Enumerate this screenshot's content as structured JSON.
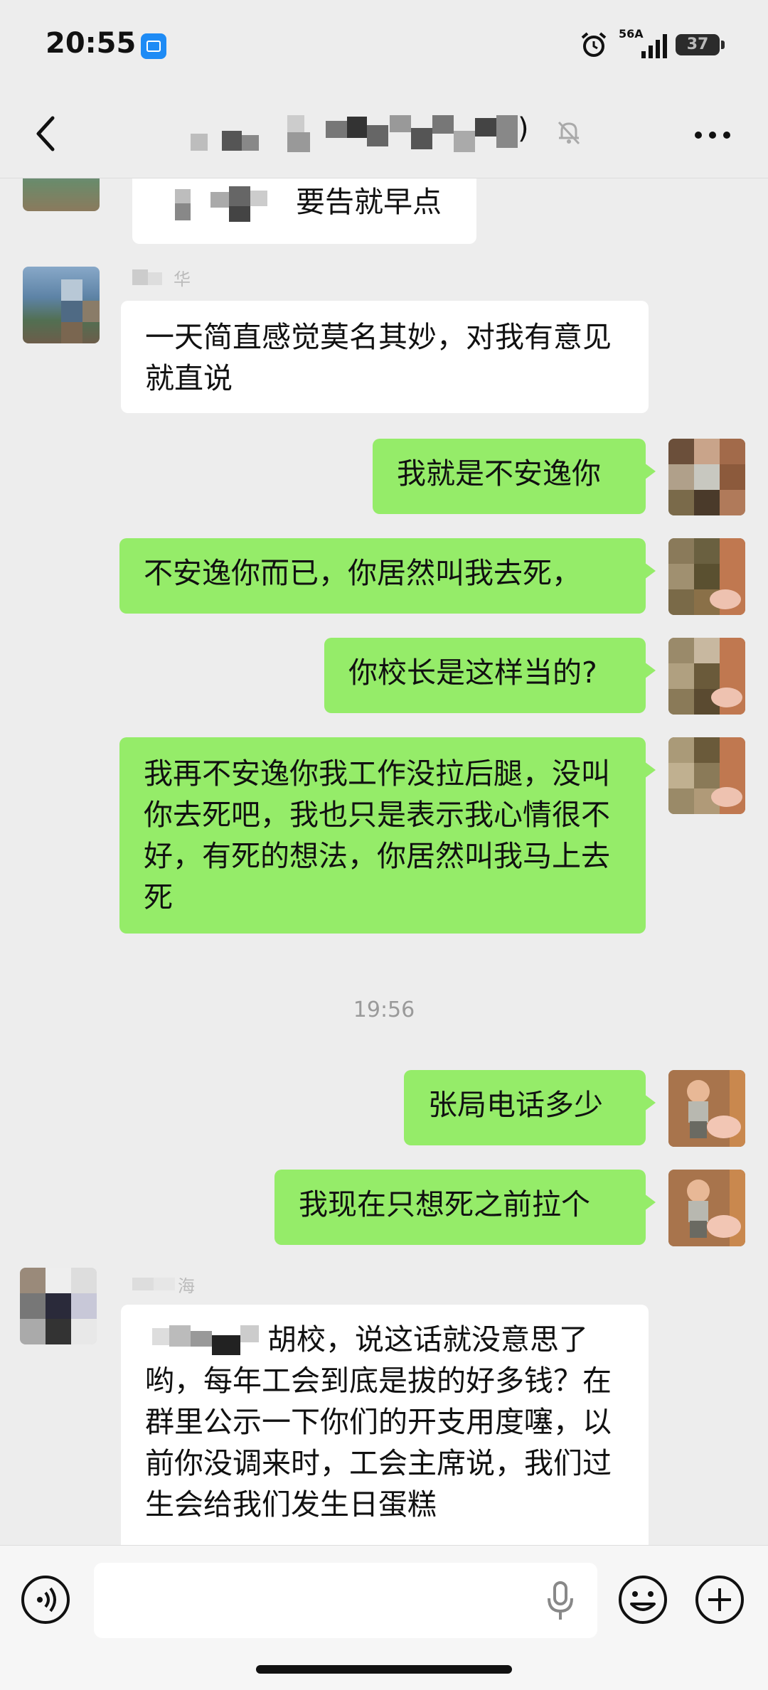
{
  "status_bar": {
    "time": "20:55",
    "network": "56A",
    "battery": "37"
  },
  "nav": {
    "title_visible": ")",
    "icons": [
      "back-arrow-icon",
      "mute-bell-icon",
      "more-icon"
    ]
  },
  "messages": [
    {
      "side": "left",
      "text": "要告就早点"
    },
    {
      "side": "left",
      "text": "一天简直感觉莫名其妙，对我有意见就直说"
    },
    {
      "side": "right",
      "text": "我就是不安逸你"
    },
    {
      "side": "right",
      "text": "不安逸你而已，你居然叫我去死，"
    },
    {
      "side": "right",
      "text": "你校长是这样当的?"
    },
    {
      "side": "right",
      "text": "我再不安逸你我工作没拉后腿，没叫你去死吧，我也只是表示我心情很不好，有死的想法，你居然叫我马上去死"
    },
    {
      "timestamp": "19:56"
    },
    {
      "side": "right",
      "text": "张局电话多少"
    },
    {
      "side": "right",
      "text": "我现在只想死之前拉个"
    },
    {
      "side": "left",
      "text": "胡校，说这话就没意思了哟，每年工会到底是拔的好多钱？在群里公示一下你们的开支用度噻，以前你没调来时，工会主席说，我们过生会给我们发生日蛋糕"
    }
  ],
  "input_bar": {
    "icons": [
      "voice-icon",
      "mic-icon",
      "emoji-icon",
      "plus-icon"
    ],
    "placeholder": ""
  }
}
